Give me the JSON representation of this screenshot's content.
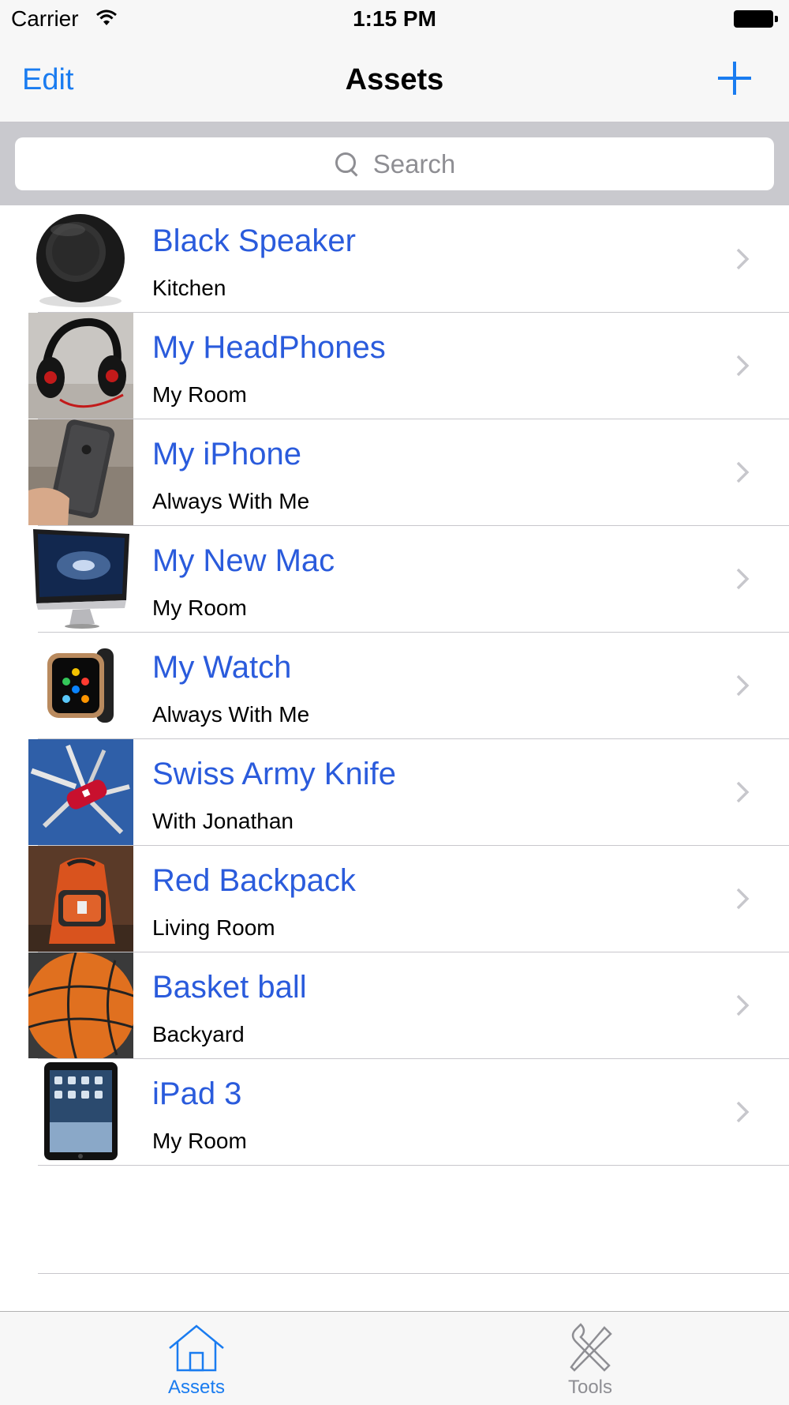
{
  "status_bar": {
    "carrier": "Carrier",
    "time": "1:15 PM"
  },
  "nav": {
    "edit_label": "Edit",
    "title": "Assets",
    "add_icon": "plus-icon"
  },
  "search": {
    "placeholder": "Search",
    "icon": "search-icon"
  },
  "assets": [
    {
      "title": "Black Speaker",
      "location": "Kitchen",
      "thumbnail": "speaker-photo"
    },
    {
      "title": "My HeadPhones",
      "location": "My Room",
      "thumbnail": "headphones-photo"
    },
    {
      "title": "My iPhone",
      "location": "Always With Me",
      "thumbnail": "iphone-photo"
    },
    {
      "title": "My New Mac",
      "location": "My Room",
      "thumbnail": "imac-photo"
    },
    {
      "title": "My Watch",
      "location": "Always With Me",
      "thumbnail": "watch-photo"
    },
    {
      "title": "Swiss Army Knife",
      "location": "With Jonathan",
      "thumbnail": "knife-photo"
    },
    {
      "title": "Red Backpack",
      "location": "Living Room",
      "thumbnail": "backpack-photo"
    },
    {
      "title": "Basket ball",
      "location": "Backyard",
      "thumbnail": "basketball-photo"
    },
    {
      "title": "iPad 3",
      "location": "My Room",
      "thumbnail": "ipad-photo"
    }
  ],
  "tabs": [
    {
      "label": "Assets",
      "icon": "house-icon",
      "selected": true
    },
    {
      "label": "Tools",
      "icon": "tools-icon",
      "selected": false
    }
  ],
  "colors": {
    "tint": "#1a7cf0",
    "title_blue": "#2a5bdc",
    "inactive_tab": "#8e8e93"
  }
}
